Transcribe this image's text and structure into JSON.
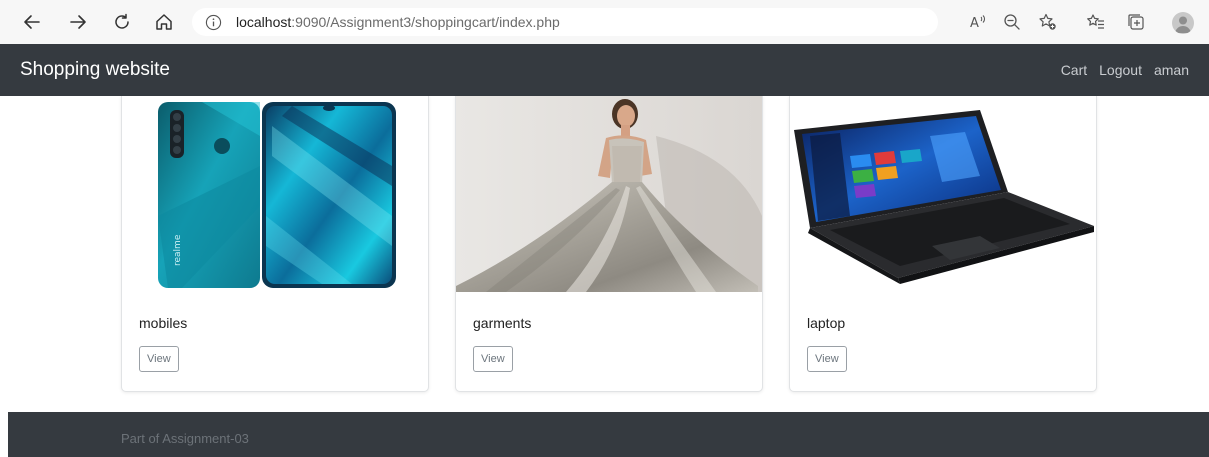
{
  "browser": {
    "url_host": "localhost",
    "url_rest": ":9090/Assignment3/shoppingcart/index.php",
    "read_aloud_label": "A⁾"
  },
  "navbar": {
    "brand": "Shopping website",
    "links": [
      "Cart",
      "Logout",
      "aman"
    ]
  },
  "products": [
    {
      "title": "mobiles",
      "button": "View"
    },
    {
      "title": "garments",
      "button": "View"
    },
    {
      "title": "laptop",
      "button": "View"
    }
  ],
  "footer": {
    "text": "Part of Assignment-03"
  },
  "colors": {
    "navbar_bg": "#353a40",
    "footer_bg": "#353a40",
    "chrome_bg": "#f7f7f7"
  }
}
